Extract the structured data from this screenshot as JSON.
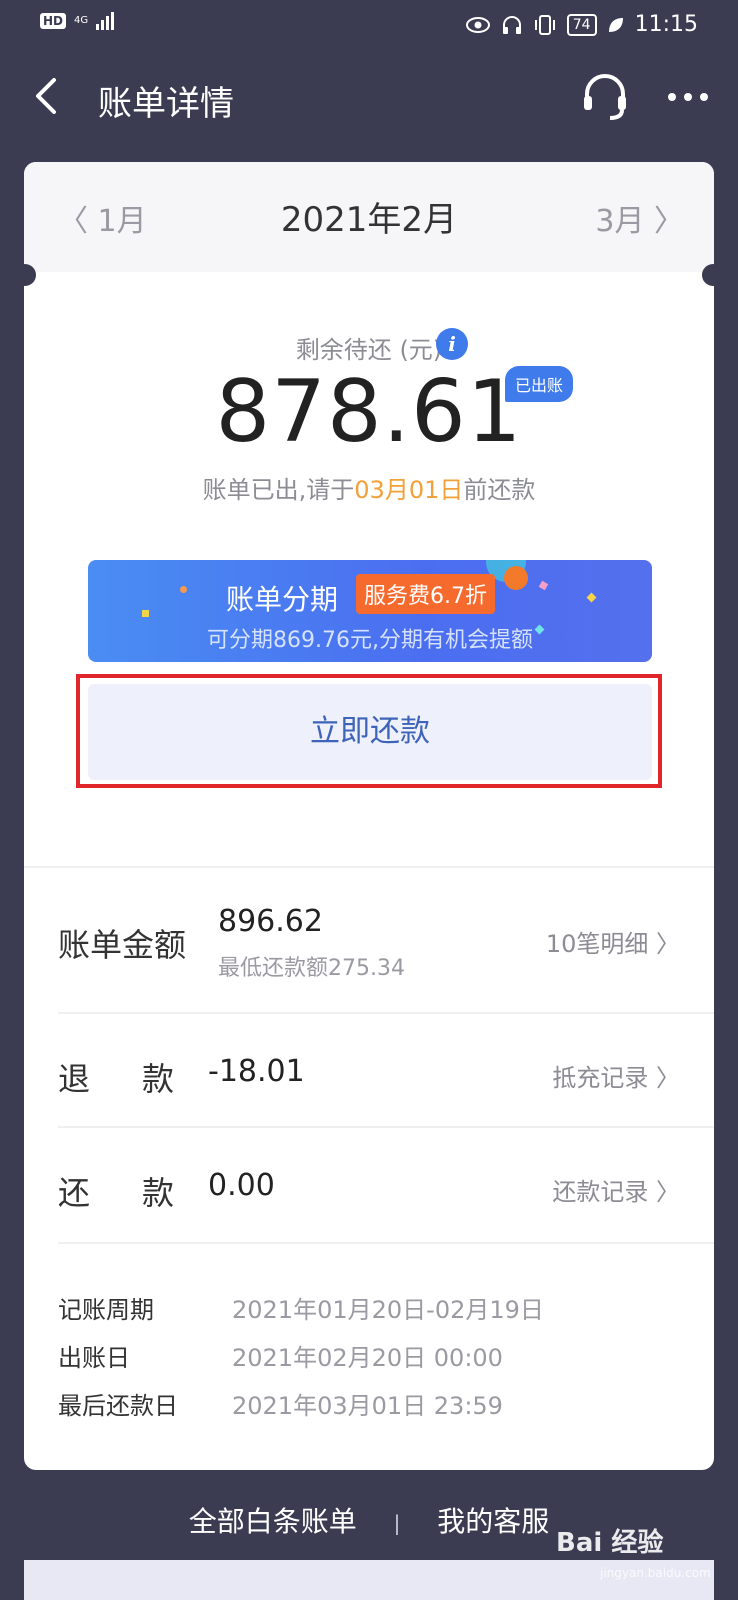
{
  "status_bar": {
    "hd": "HD",
    "network": "4G",
    "battery": "74",
    "time": "11:15"
  },
  "nav": {
    "title": "账单详情",
    "icons": [
      "back-arrow-icon",
      "headset-icon",
      "more-icon"
    ]
  },
  "month_switcher": {
    "prev": "〈 1月",
    "current": "2021年2月",
    "next": "3月 〉"
  },
  "summary": {
    "label": "剩余待还 (元)",
    "amount": "878.61",
    "badge": "已出账",
    "due_prefix": "账单已出,请于",
    "due_date": "03月01日",
    "due_suffix": "前还款"
  },
  "installment": {
    "title": "账单分期",
    "fee_badge": "服务费6.7折",
    "subtitle": "可分期869.76元,分期有机会提额"
  },
  "repay_button": "立即还款",
  "details": {
    "bill": {
      "label": "账单金额",
      "value": "896.62",
      "min_pay": "最低还款额275.34",
      "link": "10笔明细"
    },
    "refund": {
      "label_a": "退",
      "label_b": "款",
      "value": "-18.01",
      "link": "抵充记录"
    },
    "repayment": {
      "label_a": "还",
      "label_b": "款",
      "value": "0.00",
      "link": "还款记录"
    }
  },
  "period": [
    {
      "label": "记账周期",
      "value": "2021年01月20日-02月19日"
    },
    {
      "label": "出账日",
      "value": "2021年02月20日 00:00"
    },
    {
      "label": "最后还款日",
      "value": "2021年03月01日 23:59"
    }
  ],
  "footer": {
    "all_bills": "全部白条账单",
    "separator": "|",
    "service": "我的客服"
  },
  "watermark": {
    "brand": "Bai 经验",
    "site": "jingyan.baidu.com"
  },
  "colors": {
    "background": "#3b3c52",
    "accent_blue": "#3f7bea",
    "due_highlight": "#f2a03a",
    "highlight_box": "#e0262b",
    "fee_badge": "#f76a2e"
  }
}
